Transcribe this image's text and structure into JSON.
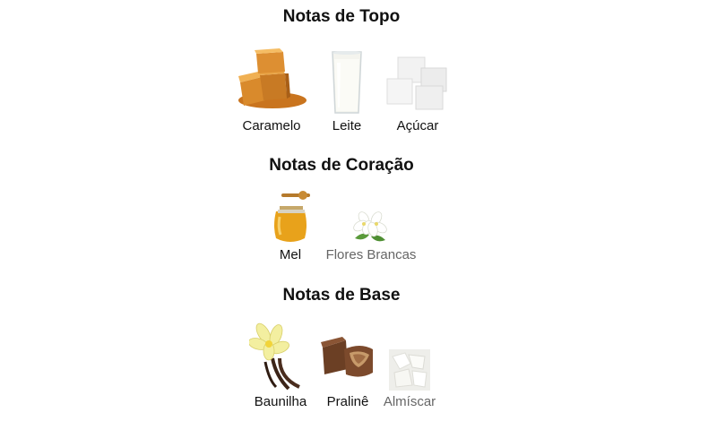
{
  "sections": {
    "top": {
      "title": "Notas de Topo",
      "notes": [
        {
          "label": "Caramelo",
          "icon": "caramel-icon"
        },
        {
          "label": "Leite",
          "icon": "milk-icon"
        },
        {
          "label": "Açúcar",
          "icon": "sugar-icon"
        }
      ]
    },
    "heart": {
      "title": "Notas de Coração",
      "notes": [
        {
          "label": "Mel",
          "icon": "honey-icon"
        },
        {
          "label": "Flores Brancas",
          "icon": "white-flowers-icon"
        }
      ]
    },
    "base": {
      "title": "Notas de Base",
      "notes": [
        {
          "label": "Baunilha",
          "icon": "vanilla-icon"
        },
        {
          "label": "Pralinê",
          "icon": "praline-icon"
        },
        {
          "label": "Almíscar",
          "icon": "musk-icon"
        }
      ]
    }
  },
  "colors": {
    "caramel": "#d9892a",
    "honey": "#e8a21b",
    "praline": "#7a4a2d",
    "muted_label": "#666666"
  }
}
